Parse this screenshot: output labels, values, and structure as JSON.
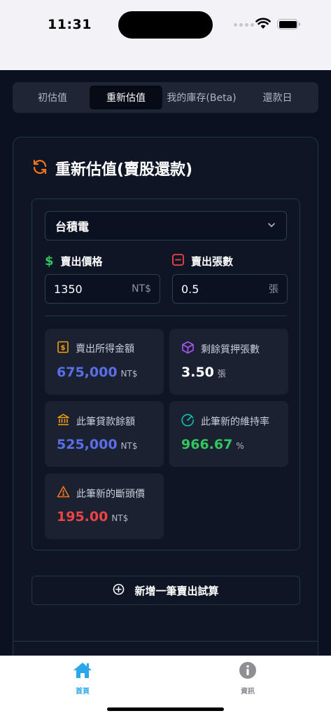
{
  "status_bar": {
    "time": "11:31"
  },
  "tabs": [
    {
      "label": "初估值",
      "active": false
    },
    {
      "label": "重新估值",
      "active": true
    },
    {
      "label": "我的庫存(Beta)",
      "active": false
    },
    {
      "label": "還款日",
      "active": false
    }
  ],
  "card": {
    "title": "重新估值(賣股還款)",
    "stock_select": {
      "value": "台積電"
    },
    "sell_price": {
      "label": "賣出價格",
      "value": "1350",
      "unit": "NT$"
    },
    "sell_qty": {
      "label": "賣出張數",
      "value": "0.5",
      "unit": "張"
    },
    "stats": {
      "proceeds": {
        "label": "賣出所得金額",
        "value": "675,000",
        "unit": "NT$"
      },
      "remaining": {
        "label": "剩餘質押張數",
        "value": "3.50",
        "unit": "張"
      },
      "loan_balance": {
        "label": "此筆貸款餘額",
        "value": "525,000",
        "unit": "NT$"
      },
      "maintenance": {
        "label": "此筆新的維持率",
        "value": "966.67",
        "unit": "%"
      },
      "liquidation": {
        "label": "此筆新的斷頭價",
        "value": "195.00",
        "unit": "NT$"
      }
    },
    "add_button": "新增一筆賣出試算"
  },
  "bottom_nav": [
    {
      "label": "首頁",
      "icon": "home-icon",
      "active": true
    },
    {
      "label": "資訊",
      "icon": "info-icon",
      "active": false
    }
  ],
  "colors": {
    "accent_blue": "#5b6ee8",
    "success_green": "#34c55e",
    "danger_red": "#ef4444",
    "warning_orange": "#f59e0b",
    "purple": "#a855f7",
    "nav_blue": "#2aa7e8",
    "refresh_orange": "#f97316"
  }
}
